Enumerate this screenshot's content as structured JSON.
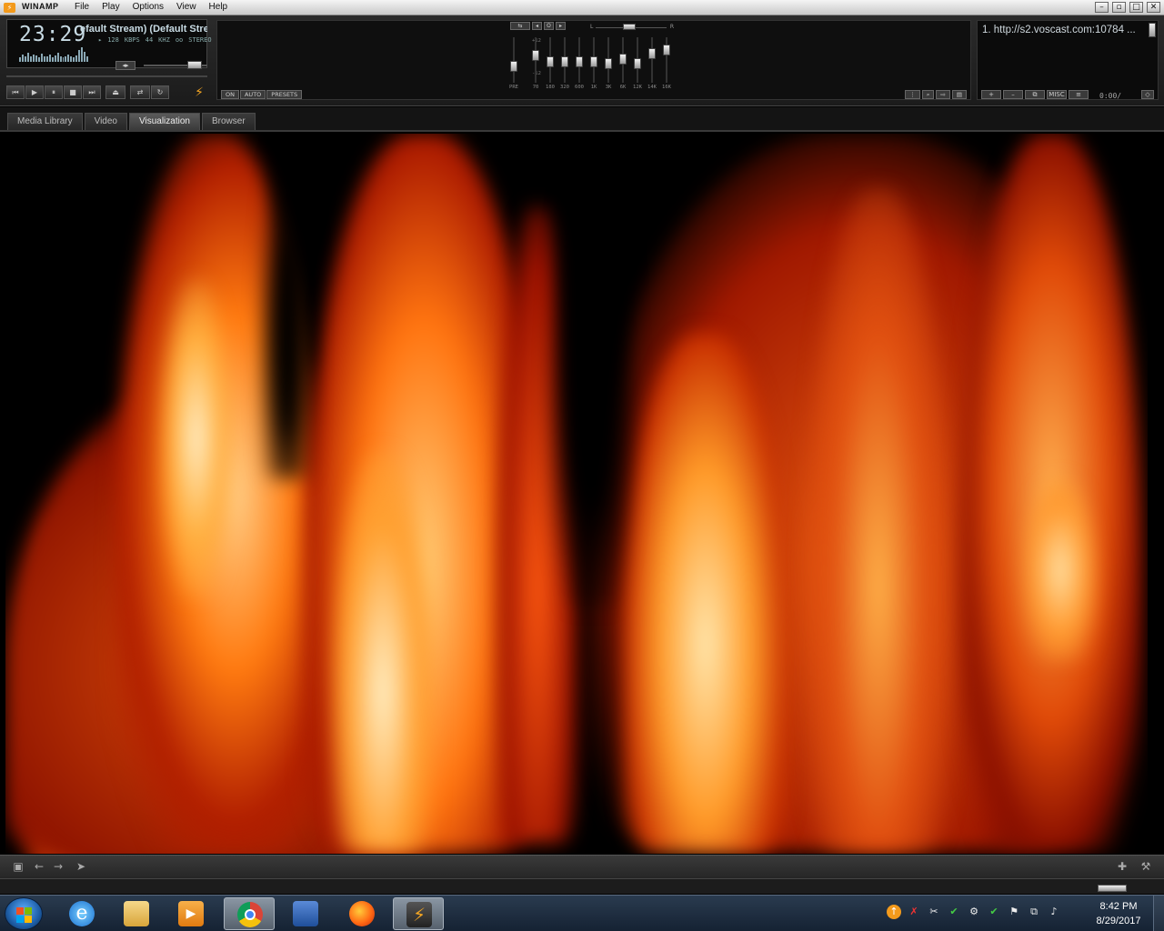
{
  "titlebar": {
    "app_name": "WINAMP",
    "menu": [
      "File",
      "Play",
      "Options",
      "View",
      "Help"
    ],
    "buttons": [
      "–",
      "▫",
      "□",
      "✕"
    ]
  },
  "player": {
    "time": "23:29",
    "title_scroll": "efault Stream) (Default Stream)",
    "bitrate": "128",
    "bitrate_unit": "KBPS",
    "samplerate": "44",
    "samplerate_unit": "KHZ",
    "channels": "STEREO",
    "spectrum_levels": [
      0.3,
      0.5,
      0.4,
      0.6,
      0.35,
      0.5,
      0.45,
      0.3,
      0.55,
      0.4,
      0.35,
      0.5,
      0.3,
      0.45,
      0.6,
      0.4,
      0.3,
      0.35,
      0.5,
      0.4,
      0.3,
      0.45,
      0.8,
      1.0,
      0.7,
      0.4
    ],
    "controls": [
      "⏮",
      "▶",
      "⏸",
      "■",
      "⏭"
    ],
    "extra_controls": [
      "⏏",
      "⇄",
      "↻"
    ]
  },
  "equalizer": {
    "top_buttons": [
      "⇆",
      "◂",
      "O",
      "▸"
    ],
    "balance_left": "L",
    "balance_right": "R",
    "db_labels": [
      "+12",
      "+0",
      "-12"
    ],
    "bands": [
      {
        "label": "PRE",
        "level": 0.0
      },
      {
        "label": "70",
        "level": 0.45
      },
      {
        "label": "180",
        "level": 0.2
      },
      {
        "label": "320",
        "level": 0.2
      },
      {
        "label": "600",
        "level": 0.2
      },
      {
        "label": "1K",
        "level": 0.2
      },
      {
        "label": "3K",
        "level": 0.1
      },
      {
        "label": "6K",
        "level": 0.3
      },
      {
        "label": "12K",
        "level": 0.1
      },
      {
        "label": "14K",
        "level": 0.55
      },
      {
        "label": "16K",
        "level": 0.7
      }
    ],
    "buttons": [
      "ON",
      "AUTO",
      "PRESETS"
    ],
    "right_buttons": [
      "⋮",
      "⌕",
      "⇨",
      "▤"
    ]
  },
  "playlist": {
    "items": [
      "1. http://s2.voscast.com:10784 ..."
    ],
    "buttons": [
      "+",
      "–",
      "⧉",
      "MISC",
      "≡"
    ],
    "time": "0:00/",
    "scroll_button": "◇"
  },
  "tabs": [
    "Media Library",
    "Video",
    "Visualization",
    "Browser"
  ],
  "active_tab": "Visualization",
  "visbar": {
    "left_icons": [
      "▣",
      "←",
      "→",
      "➤"
    ],
    "right_icons": [
      "✚",
      "⚒"
    ]
  },
  "taskbar": {
    "apps": [
      "internet-explorer",
      "file-explorer",
      "media-player",
      "chrome",
      "network-app",
      "firefox",
      "winamp"
    ],
    "active_app": "winamp",
    "tray_icons": [
      "↑",
      "✗",
      "✂",
      "✔",
      "⚙",
      "✔",
      "⚑",
      "⧉",
      "♪"
    ],
    "time": "8:42 PM",
    "date": "8/29/2017"
  }
}
